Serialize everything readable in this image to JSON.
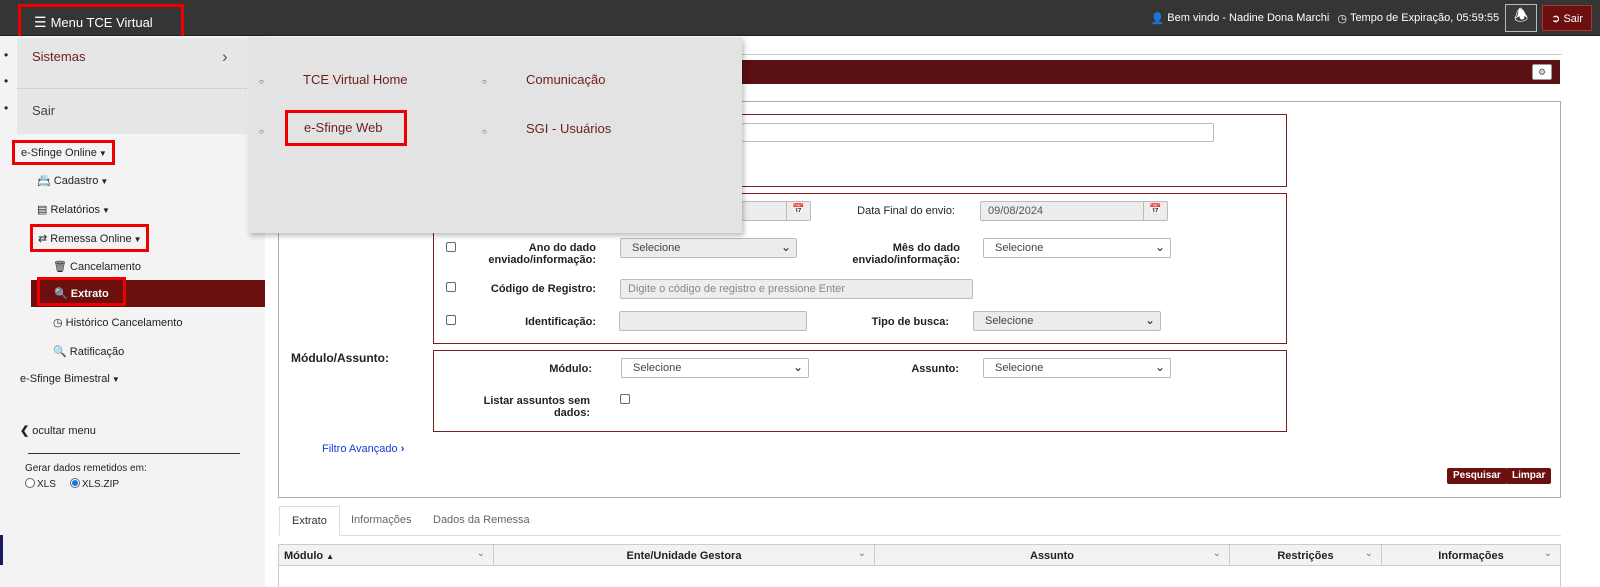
{
  "topbar": {
    "menu_label": "Menu TCE Virtual",
    "welcome": "Bem vindo - Nadine Dona Marchi",
    "expiry": "Tempo de Expiração, 05:59:55",
    "logout": "Sair"
  },
  "menu_panel": {
    "sistemas": "Sistemas",
    "sair": "Sair",
    "submenu": [
      "TCE Virtual Home",
      "Comunicação",
      "e-Sfinge Web",
      "SGI - Usuários"
    ]
  },
  "sidebar": {
    "esfinge_online": "e-Sfinge Online",
    "cadastro": "Cadastro",
    "relatorios": "Relatórios",
    "remessa_online": "Remessa Online",
    "cancelamento": "Cancelamento",
    "extrato": "Extrato",
    "historico": "Histórico Cancelamento",
    "ratificacao": "Ratificação",
    "esfinge_bimestral": "e-Sfinge Bimestral",
    "ocultar": "ocultar menu",
    "gerar_label": "Gerar dados remetidos em:",
    "opt_xls": "XLS",
    "opt_xlszip": "XLS.ZIP",
    "selected_format": "XLS.ZIP"
  },
  "form": {
    "data_final_label": "Data Final do envio:",
    "data_final_value": "09/08/2024",
    "ano_label": "Ano do dado enviado/informação:",
    "ano_value": "Selecione",
    "mes_label": "Mês do dado enviado/informação:",
    "mes_value": "Selecione",
    "codigo_label": "Código de Registro:",
    "codigo_placeholder": "Digite o código de registro e pressione Enter",
    "ident_label": "Identificação:",
    "tipo_label": "Tipo de busca:",
    "tipo_value": "Selecione",
    "modulo_assunto_title": "Módulo/Assunto:",
    "modulo_label": "Módulo:",
    "modulo_value": "Selecione",
    "assunto_label": "Assunto:",
    "assunto_value": "Selecione",
    "listar_label": "Listar assuntos sem dados:",
    "filtro_avancado": "Filtro Avançado",
    "pesquisar": "Pesquisar",
    "limpar": "Limpar"
  },
  "tabs": [
    "Extrato",
    "Informações",
    "Dados da Remessa"
  ],
  "grid_columns": [
    "Módulo",
    "Ente/Unidade Gestora",
    "Assunto",
    "Restrições",
    "Informações"
  ],
  "colors": {
    "accent": "#6b0f0f",
    "highlight_box": "#ee0000",
    "topbar": "#353535"
  }
}
